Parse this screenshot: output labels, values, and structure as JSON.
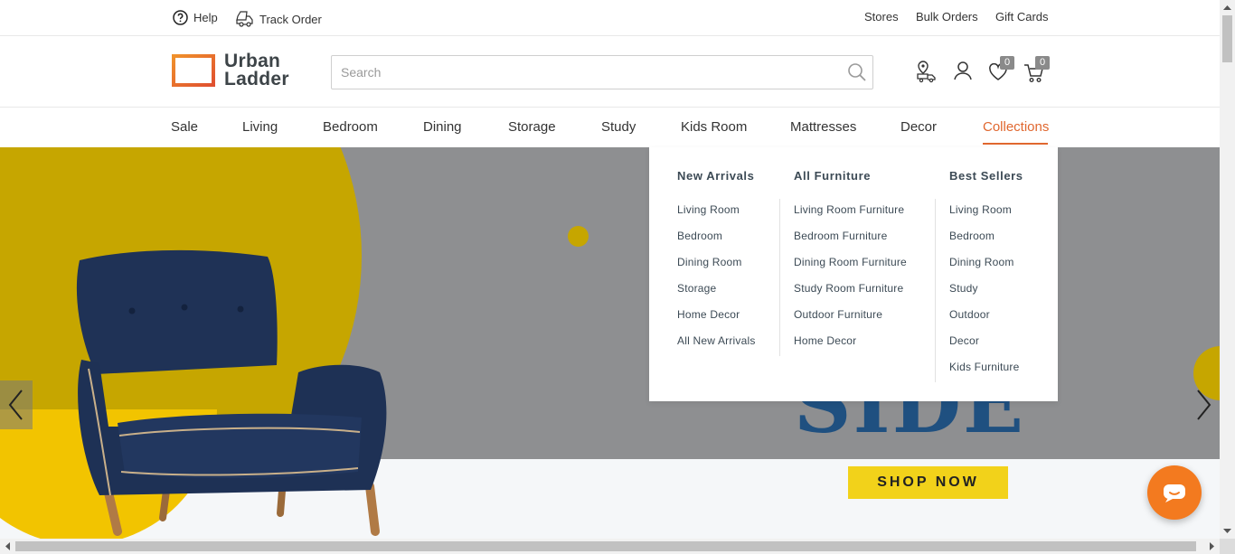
{
  "topbar": {
    "help": "Help",
    "track_order": "Track Order",
    "stores": "Stores",
    "bulk_orders": "Bulk Orders",
    "gift_cards": "Gift Cards"
  },
  "logo": {
    "line1": "Urban",
    "line2": "Ladder",
    "accent": "#e0672f"
  },
  "search": {
    "placeholder": "Search",
    "value": ""
  },
  "header_icons": {
    "wishlist_count": "0",
    "cart_count": "0"
  },
  "nav": {
    "items": [
      "Sale",
      "Living",
      "Bedroom",
      "Dining",
      "Storage",
      "Study",
      "Kids Room",
      "Mattresses",
      "Decor",
      "Collections"
    ],
    "active": "Collections",
    "active_color": "#e0672f"
  },
  "dropdown": {
    "columns": [
      {
        "title": "New Arrivals",
        "links": [
          "Living Room",
          "Bedroom",
          "Dining Room",
          "Storage",
          "Home Decor",
          "All New Arrivals"
        ]
      },
      {
        "title": "All Furniture",
        "links": [
          "Living Room Furniture",
          "Bedroom Furniture",
          "Dining Room Furniture",
          "Study Room Furniture",
          "Outdoor Furniture",
          "Home Decor"
        ]
      },
      {
        "title": "Best Sellers",
        "links": [
          "Living Room",
          "Bedroom",
          "Dining Room",
          "Study",
          "Outdoor",
          "Decor",
          "Kids Furniture"
        ]
      }
    ]
  },
  "hero": {
    "headline": "SIDE",
    "cta": "SHOP NOW"
  }
}
